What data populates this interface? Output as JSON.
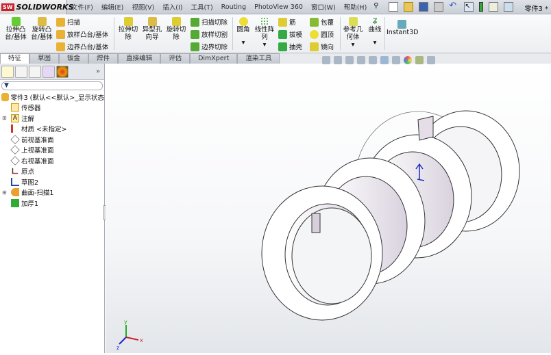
{
  "app": {
    "brand": "SOLIDWORKS",
    "brand_badge": "SW",
    "document": "零件3 *"
  },
  "menu": [
    "文件(F)",
    "编辑(E)",
    "视图(V)",
    "插入(I)",
    "工具(T)",
    "Routing",
    "PhotoView 360",
    "窗口(W)",
    "帮助(H)"
  ],
  "ribbon": {
    "extrude_boss": "拉伸凸\n台/基体",
    "revolve_boss": "旋转凸\n台/基体",
    "sweep": "扫描",
    "loft_boss": "放样凸台/基体",
    "boundary_boss": "边界凸台/基体",
    "extrude_cut": "拉伸切\n除",
    "hole_wizard": "异型孔\n向导",
    "revolve_cut": "旋转切\n除",
    "swept_cut": "扫描切除",
    "lofted_cut": "放样切割",
    "boundary_cut": "边界切除",
    "fillet": "圆角",
    "linear_pattern": "线性阵\n列",
    "rib": "筋",
    "draft": "拔模",
    "shell": "抽壳",
    "wrap": "包覆",
    "dome": "圆顶",
    "mirror": "镜向",
    "ref_geometry": "参考几\n何体",
    "curves": "曲线",
    "instant3d": "Instant3D"
  },
  "tabs": [
    "特征",
    "草图",
    "钣金",
    "焊件",
    "直接编辑",
    "评估",
    "DimXpert",
    "渲染工具"
  ],
  "tree": {
    "root": "零件3  (默认<<默认>_显示状态",
    "items": [
      {
        "label": "传感器",
        "expand": false
      },
      {
        "label": "注解",
        "expand": true
      },
      {
        "label": "材质 <未指定>",
        "expand": false
      },
      {
        "label": "前视基准面",
        "expand": false
      },
      {
        "label": "上视基准面",
        "expand": false
      },
      {
        "label": "右视基准面",
        "expand": false
      },
      {
        "label": "原点",
        "expand": false
      },
      {
        "label": "草图2",
        "expand": false
      },
      {
        "label": "曲面-扫描1",
        "expand": true
      },
      {
        "label": "加厚1",
        "expand": false
      }
    ],
    "collapse": "»",
    "filter": "▼"
  },
  "triad": {
    "x": "x",
    "y": "y",
    "z": "z"
  }
}
